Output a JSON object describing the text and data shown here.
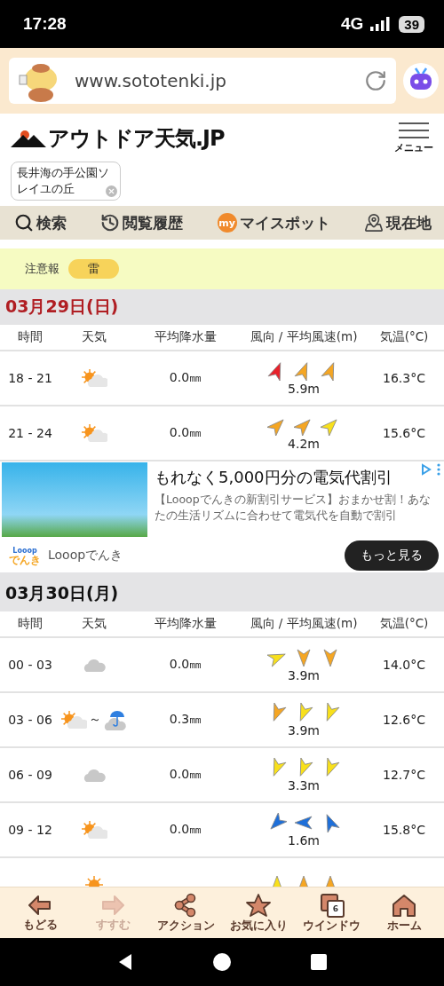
{
  "status_bar": {
    "time": "17:28",
    "network": "4G",
    "battery": "39"
  },
  "browser": {
    "url": "www.sototenki.jp"
  },
  "header": {
    "logo": "アウトドア天気.JP",
    "menu_label": "メニュー"
  },
  "location_chip": {
    "label": "長井海の手公園ソレイユの丘"
  },
  "nav": [
    {
      "label": "検索",
      "kind": "search"
    },
    {
      "label": "閲覧履歴",
      "kind": "history"
    },
    {
      "label": "マイスポット",
      "kind": "myspot",
      "badge": "my"
    },
    {
      "label": "現在地",
      "kind": "location"
    }
  ],
  "alert": {
    "label": "注意報",
    "items": [
      "雷"
    ]
  },
  "content": [
    {
      "kind": "day",
      "date": "03月29日(日)",
      "color": "#b01e23",
      "columns": [
        "時間",
        "天気",
        "平均降水量",
        "風向 / 平均風速(m)",
        "気温(°C)"
      ],
      "rows": [
        {
          "time": "18 - 21",
          "weather": [
            {
              "kind": "sun-cloud"
            }
          ],
          "precip": "0.0㎜",
          "wind": [
            {
              "kind": "nne",
              "color": "#e8212b"
            },
            {
              "kind": "nne",
              "color": "#f5a623"
            },
            {
              "kind": "nne",
              "color": "#f5a623"
            }
          ],
          "speed": "5.9m",
          "temp": "16.3°C"
        },
        {
          "time": "21 - 24",
          "weather": [
            {
              "kind": "sun-cloud"
            }
          ],
          "precip": "0.0㎜",
          "wind": [
            {
              "kind": "ne",
              "color": "#f5a623"
            },
            {
              "kind": "ne",
              "color": "#f5a623"
            },
            {
              "kind": "ne",
              "color": "#f8e01c"
            }
          ],
          "speed": "4.2m",
          "temp": "15.6°C"
        }
      ]
    },
    {
      "kind": "ad",
      "title": "もれなく5,000円分の電気代割引",
      "description": "【Looopでんきの新割引サービス】おまかせ割！あなたの生活リズムに合わせて電気代を自動で割引",
      "logo": [
        "Looop",
        "でんき"
      ],
      "advertiser": "Looopでんき",
      "button": "もっと見る"
    },
    {
      "kind": "day",
      "date": "03月30日(月)",
      "color": "#111111",
      "columns": [
        "時間",
        "天気",
        "平均降水量",
        "風向 / 平均風速(m)",
        "気温(°C)"
      ],
      "rows": [
        {
          "time": "00 - 03",
          "weather": [
            {
              "kind": "cloud"
            }
          ],
          "precip": "0.0㎜",
          "wind": [
            {
              "kind": "ene",
              "color": "#f8e01c"
            },
            {
              "kind": "s",
              "color": "#f5a623"
            },
            {
              "kind": "s",
              "color": "#f5a623"
            }
          ],
          "speed": "3.9m",
          "temp": "14.0°C"
        },
        {
          "time": "03 - 06",
          "weather": [
            {
              "kind": "sun-cloud"
            },
            {
              "kind": "rain-cloud"
            }
          ],
          "weather_separator": "～",
          "precip": "0.3㎜",
          "wind": [
            {
              "kind": "ssw",
              "color": "#f5a623"
            },
            {
              "kind": "ssw",
              "color": "#f8e01c"
            },
            {
              "kind": "ssw",
              "color": "#f8e01c"
            }
          ],
          "speed": "3.9m",
          "temp": "12.6°C"
        },
        {
          "time": "06 - 09",
          "weather": [
            {
              "kind": "cloud"
            }
          ],
          "precip": "0.0㎜",
          "wind": [
            {
              "kind": "ssw",
              "color": "#f8e01c"
            },
            {
              "kind": "ssw",
              "color": "#f8e01c"
            },
            {
              "kind": "ssw",
              "color": "#f8e01c"
            }
          ],
          "speed": "3.3m",
          "temp": "12.7°C"
        },
        {
          "time": "09 - 12",
          "weather": [
            {
              "kind": "sun-cloud"
            }
          ],
          "precip": "0.0㎜",
          "wind": [
            {
              "kind": "sw",
              "color": "#1e6fd9"
            },
            {
              "kind": "w",
              "color": "#1e6fd9"
            },
            {
              "kind": "nnw",
              "color": "#1e6fd9"
            }
          ],
          "speed": "1.6m",
          "temp": "15.8°C"
        },
        {
          "weather": [
            {
              "kind": "sun"
            }
          ],
          "wind": [
            {
              "kind": "n",
              "color": "#f8e01c"
            },
            {
              "kind": "n",
              "color": "#f5a623"
            },
            {
              "kind": "n",
              "color": "#f5a623"
            }
          ]
        }
      ]
    }
  ],
  "toolbar": [
    {
      "label": "もどる",
      "kind": "back",
      "disabled": false
    },
    {
      "label": "すすむ",
      "kind": "forward",
      "disabled": true
    },
    {
      "label": "アクション",
      "kind": "share",
      "disabled": false
    },
    {
      "label": "お気に入り",
      "kind": "star",
      "disabled": false
    },
    {
      "label": "ウインドウ",
      "kind": "windows",
      "count": "6",
      "disabled": false
    },
    {
      "label": "ホーム",
      "kind": "home",
      "disabled": false
    }
  ]
}
